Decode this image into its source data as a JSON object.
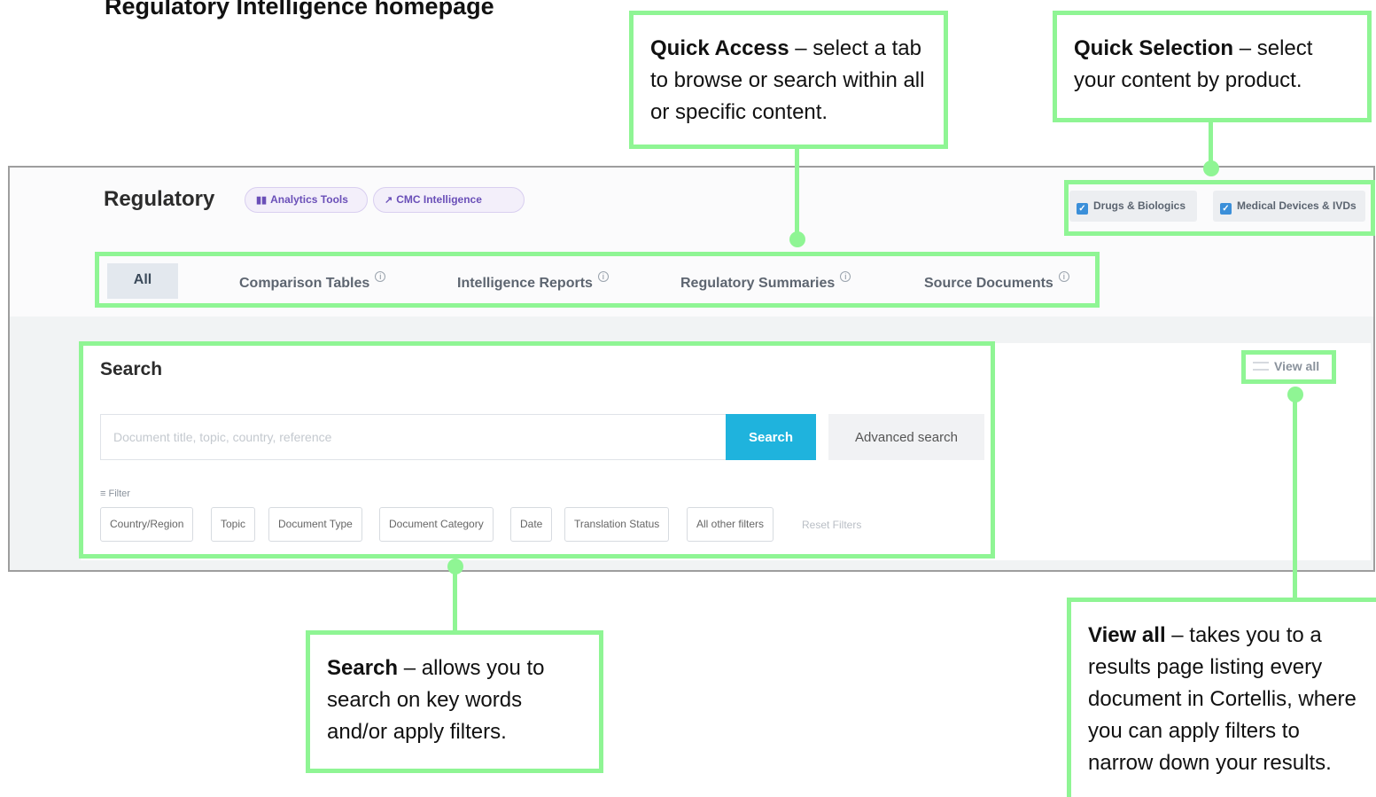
{
  "page_title": "Regulatory Intelligence homepage",
  "app": {
    "brand": "Regulatory",
    "tools": [
      {
        "label": "Analytics Tools",
        "icon": "bar-chart-icon"
      },
      {
        "label": "CMC Intelligence",
        "icon": "external-link-icon"
      }
    ],
    "products": [
      {
        "label": "Drugs & Biologics",
        "checked": true
      },
      {
        "label": "Medical Devices & IVDs",
        "checked": true
      }
    ],
    "tabs": [
      {
        "label": "All",
        "active": true
      },
      {
        "label": "Comparison Tables",
        "info": true
      },
      {
        "label": "Intelligence Reports",
        "info": true
      },
      {
        "label": "Regulatory Summaries",
        "info": true
      },
      {
        "label": "Source Documents",
        "info": true
      }
    ]
  },
  "search": {
    "title": "Search",
    "placeholder": "Document title, topic, country, reference",
    "button_label": "Search",
    "advanced_label": "Advanced search",
    "view_all_label": "View all",
    "filter_label": "Filter",
    "filters": [
      "Country/Region",
      "Topic",
      "Document Type",
      "Document Category",
      "Date",
      "Translation Status",
      "All other filters"
    ],
    "reset_label": "Reset Filters"
  },
  "callouts": {
    "quick_access": {
      "lead": "Quick Access",
      "text": " – select a tab to browse or search within all or specific content."
    },
    "quick_selection": {
      "lead": "Quick Selection",
      "text": " – select your content by product."
    },
    "search": {
      "lead": "Search",
      "text": " – allows you to search on key words and/or apply filters."
    },
    "view_all": {
      "lead": "View all",
      "text": " – takes you to a results page listing every document in Cortellis, where you can apply filters to narrow down your results."
    }
  },
  "colors": {
    "highlight": "#8ff594",
    "search_button": "#1fb3dd",
    "pill_text": "#6a4fb8",
    "checkbox": "#3b8fd9"
  }
}
